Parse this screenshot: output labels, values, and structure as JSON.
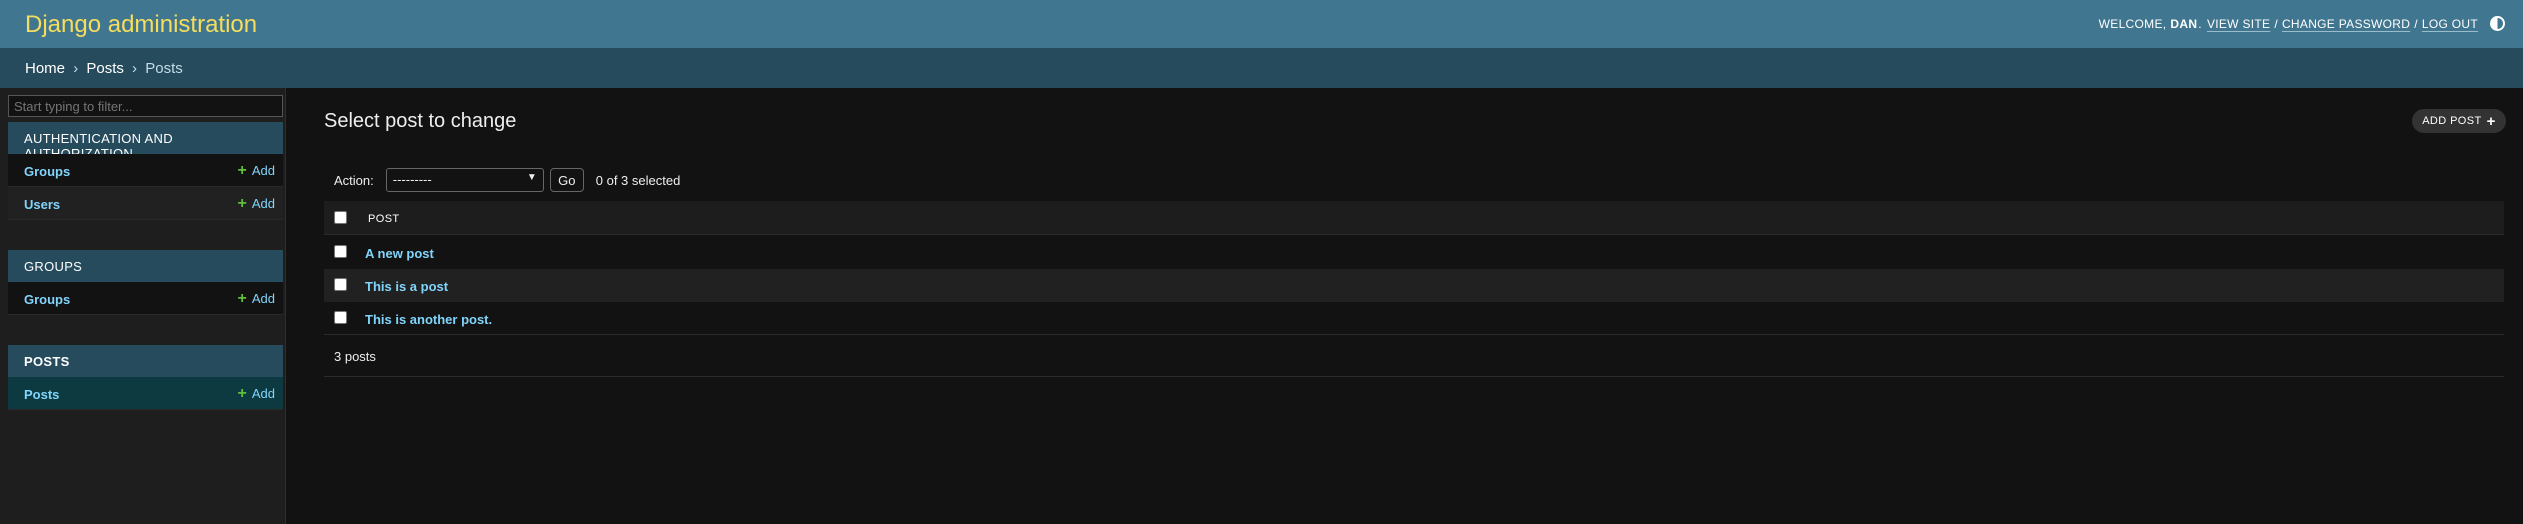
{
  "header": {
    "brand": "Django administration",
    "welcome": "WELCOME,",
    "username": "DAN",
    "view_site": "VIEW SITE",
    "change_password": "CHANGE PASSWORD",
    "log_out": "LOG OUT",
    "separator": "/"
  },
  "breadcrumbs": {
    "home": "Home",
    "app": "Posts",
    "model": "Posts",
    "arrow": "›"
  },
  "sidebar": {
    "filter_placeholder": "Start typing to filter...",
    "modules": [
      {
        "caption": "AUTHENTICATION AND AUTHORIZATION",
        "rows": [
          {
            "label": "Groups",
            "add": "Add"
          },
          {
            "label": "Users",
            "add": "Add"
          }
        ]
      },
      {
        "caption": "GROUPS",
        "rows": [
          {
            "label": "Groups",
            "add": "Add"
          }
        ]
      },
      {
        "caption": "POSTS",
        "rows": [
          {
            "label": "Posts",
            "add": "Add"
          }
        ]
      }
    ]
  },
  "content": {
    "title": "Select post to change",
    "add_button": "ADD POST",
    "add_icon": "+",
    "action_label": "Action:",
    "action_selected": "---------",
    "go_label": "Go",
    "selection_counter": "0 of 3 selected",
    "column_header": "POST",
    "rows": [
      "A new post",
      "This is a post",
      "This is another post."
    ],
    "paginator": "3 posts"
  },
  "icons": {
    "plus": "+",
    "select_chevron": "chevron-down-icon",
    "theme_toggle": "theme-toggle-icon"
  },
  "colors": {
    "header_bg": "#417690",
    "brand_text": "#f5dd5d",
    "breadcrumbs_bg": "#264b5d",
    "link": "#81d4fa",
    "add_plus": "#5fbf38",
    "body_bg": "#121212"
  }
}
